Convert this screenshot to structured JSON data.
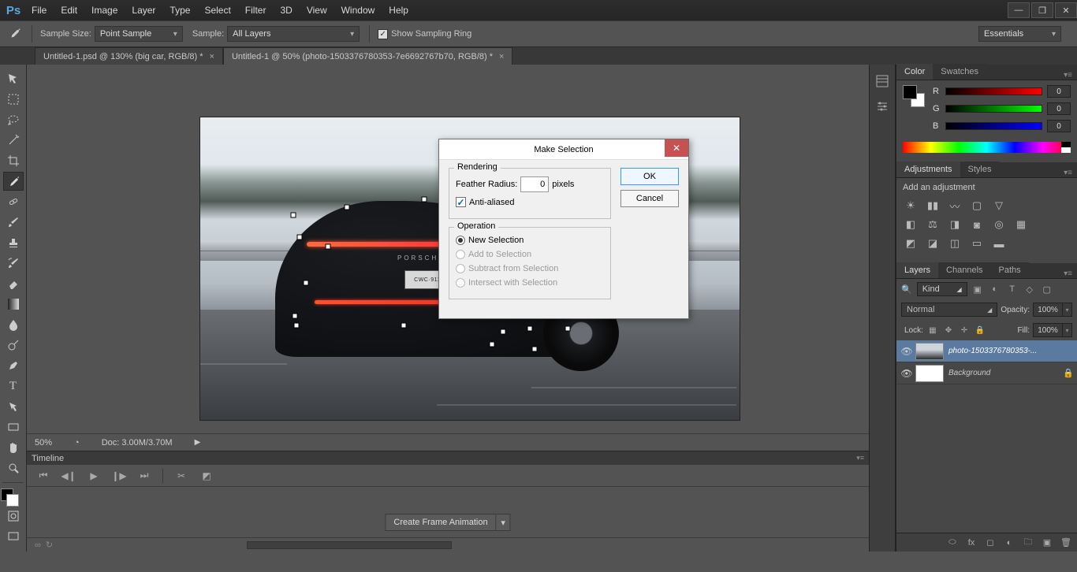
{
  "menu": [
    "File",
    "Edit",
    "Image",
    "Layer",
    "Type",
    "Select",
    "Filter",
    "3D",
    "View",
    "Window",
    "Help"
  ],
  "options": {
    "sample_size_label": "Sample Size:",
    "sample_size_value": "Point Sample",
    "sample_label": "Sample:",
    "sample_value": "All Layers",
    "show_ring": "Show Sampling Ring",
    "workspace": "Essentials"
  },
  "tabs": {
    "t1": "Untitled-1.psd @ 130% (big car, RGB/8) *",
    "t2": "Untitled-1 @ 50% (photo-1503376780353-7e6692767b70, RGB/8) *"
  },
  "status": {
    "zoom": "50%",
    "doc": "Doc: 3.00M/3.70M"
  },
  "timeline": {
    "title": "Timeline",
    "frame_btn": "Create Frame Animation"
  },
  "panels": {
    "color_tab": "Color",
    "swatches_tab": "Swatches",
    "r": "R",
    "g": "G",
    "b": "B",
    "rv": "0",
    "gv": "0",
    "bv": "0",
    "adj_tab": "Adjustments",
    "styles_tab": "Styles",
    "adj_title": "Add an adjustment",
    "layers_tab": "Layers",
    "channels_tab": "Channels",
    "paths_tab": "Paths",
    "kind": "Kind",
    "blend": "Normal",
    "opacity_lbl": "Opacity:",
    "opacity": "100%",
    "lock_lbl": "Lock:",
    "fill_lbl": "Fill:",
    "fill": "100%",
    "layer1": "photo-1503376780353-...",
    "layer2": "Background"
  },
  "car": {
    "brand": "PORSCHE",
    "plate": "CWC·911"
  },
  "dialog": {
    "title": "Make Selection",
    "ok": "OK",
    "cancel": "Cancel",
    "rendering": "Rendering",
    "feather_label": "Feather Radius:",
    "feather_value": "0",
    "pixels": "pixels",
    "aa": "Anti-aliased",
    "operation": "Operation",
    "op_new": "New Selection",
    "op_add": "Add to Selection",
    "op_sub": "Subtract from Selection",
    "op_int": "Intersect with Selection"
  }
}
